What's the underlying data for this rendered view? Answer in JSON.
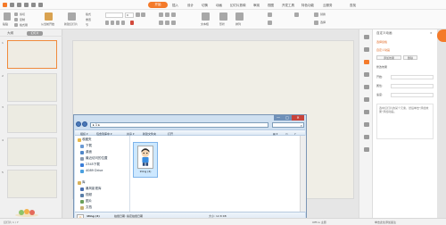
{
  "menubar": {
    "items": [
      "开始",
      "插入",
      "设计",
      "切换",
      "动画",
      "幻灯片放映",
      "审阅",
      "视图",
      "开发工具",
      "特色功能",
      "云服务",
      "查找"
    ],
    "active_index": 0
  },
  "toolbar": {
    "paste": "粘贴",
    "cut": "剪切",
    "copy": "复制",
    "format_painter": "格式刷",
    "from_current": "从当前开始",
    "new_slide": "新建幻灯片",
    "layout": "版式",
    "reset": "重置",
    "section": "节",
    "font_size": "0",
    "text_box": "文本框",
    "shapes": "形状",
    "arrange": "排列",
    "replace": "替换",
    "select": "选择"
  },
  "slide_panel": {
    "tab_outline": "大纲",
    "tab_slides": "幻灯片",
    "thumbs": [
      "1",
      "2",
      "3",
      "4",
      "5",
      "6",
      "7"
    ]
  },
  "anim_panel": {
    "header": "自定义动画",
    "select_pane": "选择窗格",
    "custom_anim": "自定义动画",
    "add_effect": "添加效果",
    "remove": "删除",
    "modify": "修改效果",
    "start": "开始:",
    "property": "属性:",
    "speed": "速度:",
    "hint": "选中幻灯片的某个元素，然后单击\"添加效果\"添加动画。"
  },
  "explorer": {
    "address": "▸ 1 ▸",
    "controls": [
      "—",
      "□",
      "✕"
    ],
    "commands": [
      "组织 ▾",
      "包含到库中 ▾",
      "共享 ▾",
      "新建文件夹",
      "打开"
    ],
    "nav": {
      "favorites": "收藏夹",
      "fav_items": [
        "下载",
        "桌面",
        "最近访问的位置",
        "2345下载",
        "4089 Drive"
      ],
      "libraries": "库",
      "lib_items": [
        "暴风影视库",
        "视频",
        "图片",
        "文档"
      ]
    },
    "file": {
      "name": "1ting (4)"
    },
    "details": {
      "name": "1ting (4)",
      "type": "PNG 图像",
      "date_label": "拍摄日期: 指定拍摄日期",
      "dims_label": "分辨率: 1024 × 1297",
      "size_label": "大小: 12.8 KB"
    }
  },
  "statusbar": {
    "slide_info": "幻灯片 1 / 7",
    "theme": "Office 主题",
    "notes": "单击此处添加备注"
  },
  "colors": {
    "accent": "#f47a2a",
    "explorer_frame": "#cfe0f1"
  }
}
